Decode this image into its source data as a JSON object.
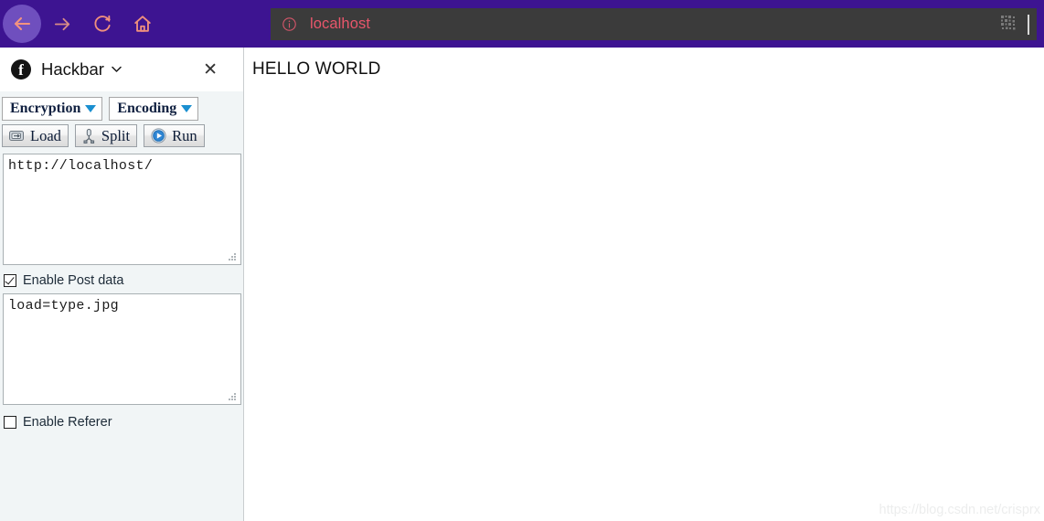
{
  "browser": {
    "nav": {
      "back_icon": "arrow-left-icon",
      "forward_icon": "arrow-right-icon",
      "reload_icon": "reload-icon",
      "home_icon": "home-icon"
    },
    "urlbar": {
      "security_icon": "info-circle-icon",
      "value": "localhost",
      "placeholder": "Search or enter address",
      "qr_icon": "qr-code-icon"
    },
    "colors": {
      "toolbar_bg": "#3d1491",
      "urlbar_bg": "#3b3b3b",
      "url_text": "#e8566b",
      "nav_icon": "#f08a78"
    }
  },
  "sidebar": {
    "header": {
      "logo_icon": "hackbar-logo-icon",
      "logo_glyph": "f",
      "title": "Hackbar",
      "chevron_icon": "chevron-down-icon",
      "chevron_glyph": "⌄",
      "close_icon": "close-icon",
      "close_glyph": "✕"
    },
    "toolbar": {
      "encryption_label": "Encryption",
      "encoding_label": "Encoding",
      "load_label": "Load",
      "split_label": "Split",
      "run_label": "Run",
      "load_icon": "load-disk-icon",
      "split_icon": "split-tool-icon",
      "run_icon": "run-play-icon"
    },
    "url_field": {
      "value": "http://localhost/",
      "placeholder": "",
      "resize_grip_icon": "resize-grip-icon"
    },
    "post_toggle": {
      "label": "Enable Post data",
      "checked": true
    },
    "post_field": {
      "value": "load=type.jpg",
      "placeholder": "",
      "resize_grip_icon": "resize-grip-icon"
    },
    "referer_toggle": {
      "label": "Enable Referer",
      "checked": false
    }
  },
  "page": {
    "body_text": "HELLO WORLD",
    "watermark": "https://blog.csdn.net/crisprx"
  }
}
